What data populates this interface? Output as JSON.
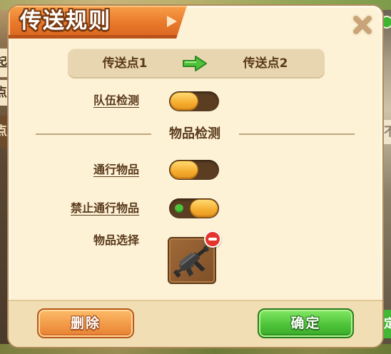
{
  "dialog": {
    "title": "传送规则"
  },
  "route": {
    "from_label": "传送点1",
    "to_label": "传送点2"
  },
  "team_check": {
    "label": "队伍检测",
    "enabled": false
  },
  "item_section": {
    "heading": "物品检测"
  },
  "pass_items": {
    "label": "通行物品",
    "enabled": false
  },
  "forbid_items": {
    "label": "禁止通行物品",
    "enabled": true
  },
  "item_select": {
    "label": "物品选择"
  },
  "footer": {
    "delete_label": "删除",
    "confirm_label": "确定"
  },
  "icons": {
    "close": "close-icon",
    "route_arrow": "arrow-right-icon",
    "selected_item": "submachine-gun-icon",
    "remove_item": "remove-circle-icon"
  },
  "colors": {
    "panel_bg": "#fdf2d6",
    "title_tab": "#e8772a",
    "text": "#5a3a1c",
    "header_bar": "#e8d6b0",
    "toggle_track": "#5b3d21",
    "toggle_knob": "#f5ac2e",
    "toggle_on_dot": "#4cc23a",
    "route_arrow": "#4fc23c",
    "delete_button": "#f29a48",
    "confirm_button": "#4ec43a",
    "remove_badge": "#e3352c",
    "footer_bg": "#f1deb4"
  },
  "background": {
    "left_fragments": [
      "起",
      "点",
      "点"
    ],
    "right_fragments": [
      "不",
      "定"
    ]
  }
}
